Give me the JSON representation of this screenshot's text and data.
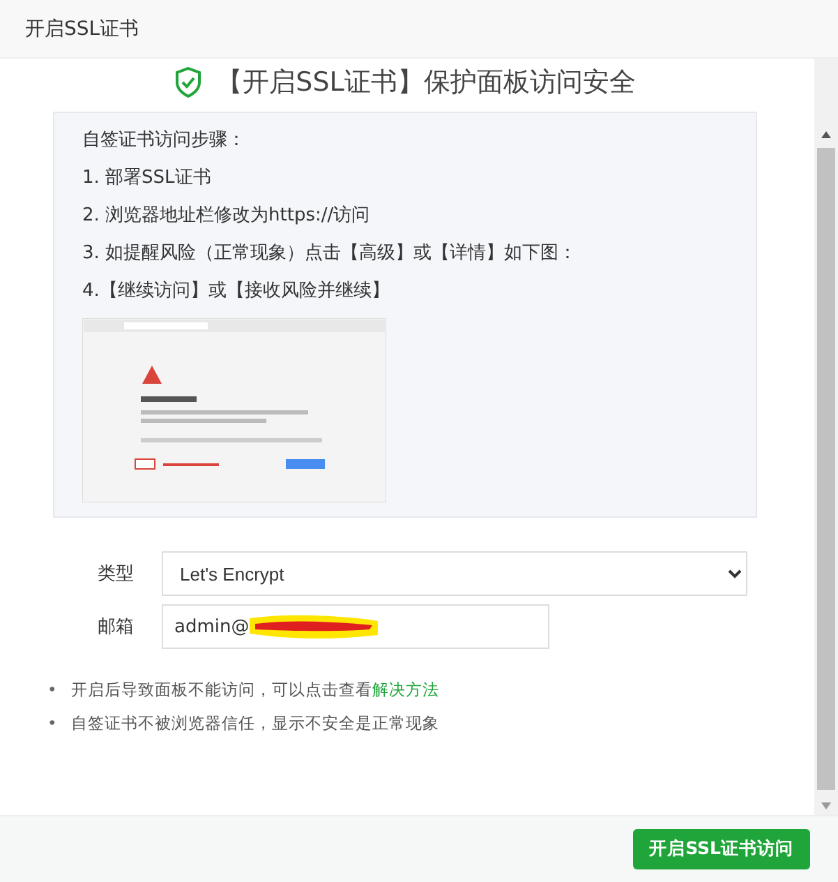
{
  "window": {
    "title": "开启SSL证书"
  },
  "heading": "【开启SSL证书】保护面板访问安全",
  "steps": {
    "title": "自签证书访问步骤：",
    "items": [
      "1. 部署SSL证书",
      "2. 浏览器地址栏修改为https://访问",
      "3. 如提醒风险（正常现象）点击【高级】或【详情】如下图：",
      "4.【继续访问】或【接收风险并继续】"
    ]
  },
  "form": [
    {
      "kind": "select",
      "label": "类型",
      "value": "Let's Encrypt"
    },
    {
      "kind": "input",
      "label": "邮箱",
      "value": "admin@",
      "redacted": true
    }
  ],
  "notes": [
    {
      "bullet": "•",
      "text": "开启后导致面板不能访问，可以点击查看",
      "link": "解决方法"
    },
    {
      "bullet": "•",
      "text": "自签证书不被浏览器信任，显示不安全是正常现象"
    }
  ],
  "buttons": [
    "开启SSL证书访问"
  ]
}
